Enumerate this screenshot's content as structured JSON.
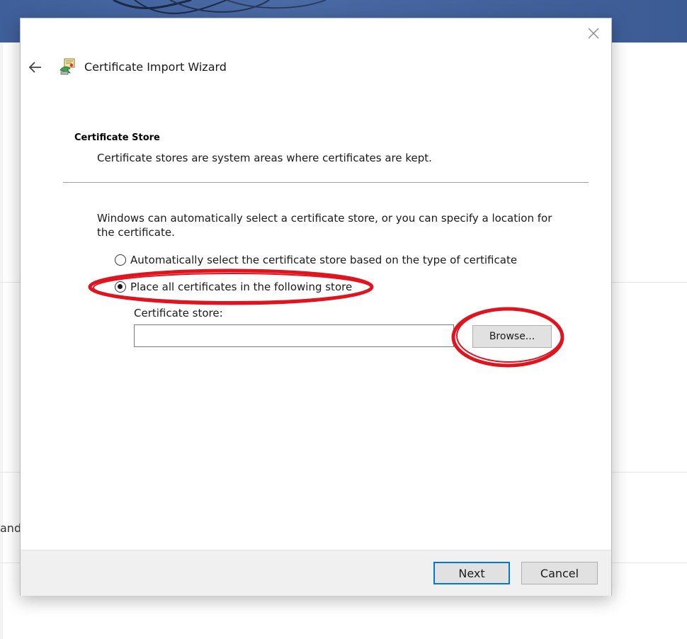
{
  "dialog": {
    "title": "Certificate Import Wizard",
    "section_heading": "Certificate Store",
    "section_description": "Certificate stores are system areas where certificates are kept.",
    "intro_text": "Windows can automatically select a certificate store, or you can specify a location for the certificate.",
    "options": [
      {
        "label": "Automatically select the certificate store based on the type of certificate",
        "checked": false
      },
      {
        "label": "Place all certificates in the following store",
        "checked": true
      }
    ],
    "store_label": "Certificate store:",
    "store_value": "",
    "browse_label": "Browse...",
    "next_label": "Next",
    "cancel_label": "Cancel"
  },
  "background": {
    "partial_text": "and"
  },
  "colors": {
    "accent": "#0078d7",
    "annotation": "#e0141e",
    "footer_bg": "#f0f0f0",
    "banner": "#3f5f9a"
  },
  "icons": {
    "close": "close-icon",
    "back": "arrow-left-icon",
    "wizard": "certificate-wizard-icon"
  }
}
